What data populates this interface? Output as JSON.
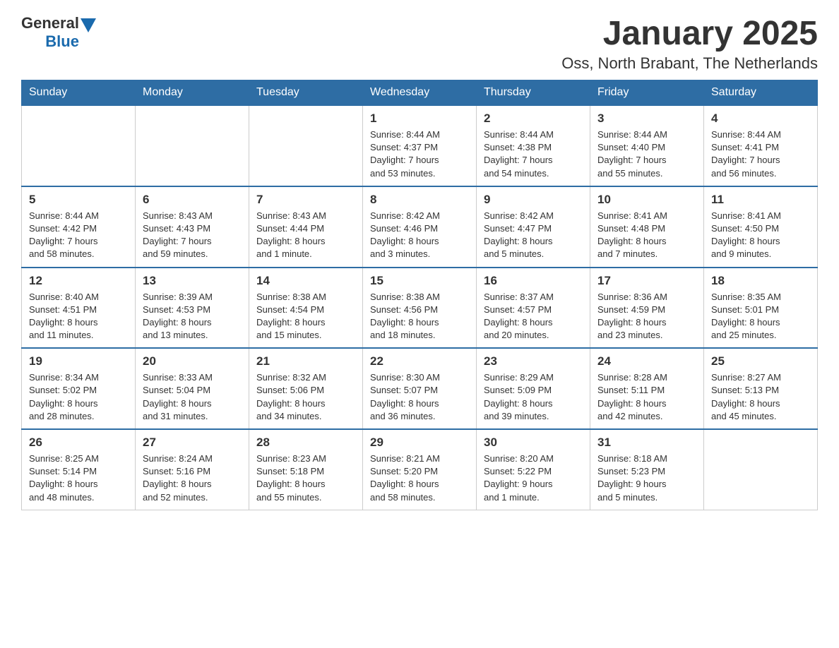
{
  "header": {
    "logo": {
      "general": "General",
      "blue": "Blue"
    },
    "title": "January 2025",
    "subtitle": "Oss, North Brabant, The Netherlands"
  },
  "calendar": {
    "days_of_week": [
      "Sunday",
      "Monday",
      "Tuesday",
      "Wednesday",
      "Thursday",
      "Friday",
      "Saturday"
    ],
    "weeks": [
      [
        {
          "day": "",
          "info": ""
        },
        {
          "day": "",
          "info": ""
        },
        {
          "day": "",
          "info": ""
        },
        {
          "day": "1",
          "info": "Sunrise: 8:44 AM\nSunset: 4:37 PM\nDaylight: 7 hours\nand 53 minutes."
        },
        {
          "day": "2",
          "info": "Sunrise: 8:44 AM\nSunset: 4:38 PM\nDaylight: 7 hours\nand 54 minutes."
        },
        {
          "day": "3",
          "info": "Sunrise: 8:44 AM\nSunset: 4:40 PM\nDaylight: 7 hours\nand 55 minutes."
        },
        {
          "day": "4",
          "info": "Sunrise: 8:44 AM\nSunset: 4:41 PM\nDaylight: 7 hours\nand 56 minutes."
        }
      ],
      [
        {
          "day": "5",
          "info": "Sunrise: 8:44 AM\nSunset: 4:42 PM\nDaylight: 7 hours\nand 58 minutes."
        },
        {
          "day": "6",
          "info": "Sunrise: 8:43 AM\nSunset: 4:43 PM\nDaylight: 7 hours\nand 59 minutes."
        },
        {
          "day": "7",
          "info": "Sunrise: 8:43 AM\nSunset: 4:44 PM\nDaylight: 8 hours\nand 1 minute."
        },
        {
          "day": "8",
          "info": "Sunrise: 8:42 AM\nSunset: 4:46 PM\nDaylight: 8 hours\nand 3 minutes."
        },
        {
          "day": "9",
          "info": "Sunrise: 8:42 AM\nSunset: 4:47 PM\nDaylight: 8 hours\nand 5 minutes."
        },
        {
          "day": "10",
          "info": "Sunrise: 8:41 AM\nSunset: 4:48 PM\nDaylight: 8 hours\nand 7 minutes."
        },
        {
          "day": "11",
          "info": "Sunrise: 8:41 AM\nSunset: 4:50 PM\nDaylight: 8 hours\nand 9 minutes."
        }
      ],
      [
        {
          "day": "12",
          "info": "Sunrise: 8:40 AM\nSunset: 4:51 PM\nDaylight: 8 hours\nand 11 minutes."
        },
        {
          "day": "13",
          "info": "Sunrise: 8:39 AM\nSunset: 4:53 PM\nDaylight: 8 hours\nand 13 minutes."
        },
        {
          "day": "14",
          "info": "Sunrise: 8:38 AM\nSunset: 4:54 PM\nDaylight: 8 hours\nand 15 minutes."
        },
        {
          "day": "15",
          "info": "Sunrise: 8:38 AM\nSunset: 4:56 PM\nDaylight: 8 hours\nand 18 minutes."
        },
        {
          "day": "16",
          "info": "Sunrise: 8:37 AM\nSunset: 4:57 PM\nDaylight: 8 hours\nand 20 minutes."
        },
        {
          "day": "17",
          "info": "Sunrise: 8:36 AM\nSunset: 4:59 PM\nDaylight: 8 hours\nand 23 minutes."
        },
        {
          "day": "18",
          "info": "Sunrise: 8:35 AM\nSunset: 5:01 PM\nDaylight: 8 hours\nand 25 minutes."
        }
      ],
      [
        {
          "day": "19",
          "info": "Sunrise: 8:34 AM\nSunset: 5:02 PM\nDaylight: 8 hours\nand 28 minutes."
        },
        {
          "day": "20",
          "info": "Sunrise: 8:33 AM\nSunset: 5:04 PM\nDaylight: 8 hours\nand 31 minutes."
        },
        {
          "day": "21",
          "info": "Sunrise: 8:32 AM\nSunset: 5:06 PM\nDaylight: 8 hours\nand 34 minutes."
        },
        {
          "day": "22",
          "info": "Sunrise: 8:30 AM\nSunset: 5:07 PM\nDaylight: 8 hours\nand 36 minutes."
        },
        {
          "day": "23",
          "info": "Sunrise: 8:29 AM\nSunset: 5:09 PM\nDaylight: 8 hours\nand 39 minutes."
        },
        {
          "day": "24",
          "info": "Sunrise: 8:28 AM\nSunset: 5:11 PM\nDaylight: 8 hours\nand 42 minutes."
        },
        {
          "day": "25",
          "info": "Sunrise: 8:27 AM\nSunset: 5:13 PM\nDaylight: 8 hours\nand 45 minutes."
        }
      ],
      [
        {
          "day": "26",
          "info": "Sunrise: 8:25 AM\nSunset: 5:14 PM\nDaylight: 8 hours\nand 48 minutes."
        },
        {
          "day": "27",
          "info": "Sunrise: 8:24 AM\nSunset: 5:16 PM\nDaylight: 8 hours\nand 52 minutes."
        },
        {
          "day": "28",
          "info": "Sunrise: 8:23 AM\nSunset: 5:18 PM\nDaylight: 8 hours\nand 55 minutes."
        },
        {
          "day": "29",
          "info": "Sunrise: 8:21 AM\nSunset: 5:20 PM\nDaylight: 8 hours\nand 58 minutes."
        },
        {
          "day": "30",
          "info": "Sunrise: 8:20 AM\nSunset: 5:22 PM\nDaylight: 9 hours\nand 1 minute."
        },
        {
          "day": "31",
          "info": "Sunrise: 8:18 AM\nSunset: 5:23 PM\nDaylight: 9 hours\nand 5 minutes."
        },
        {
          "day": "",
          "info": ""
        }
      ]
    ]
  }
}
